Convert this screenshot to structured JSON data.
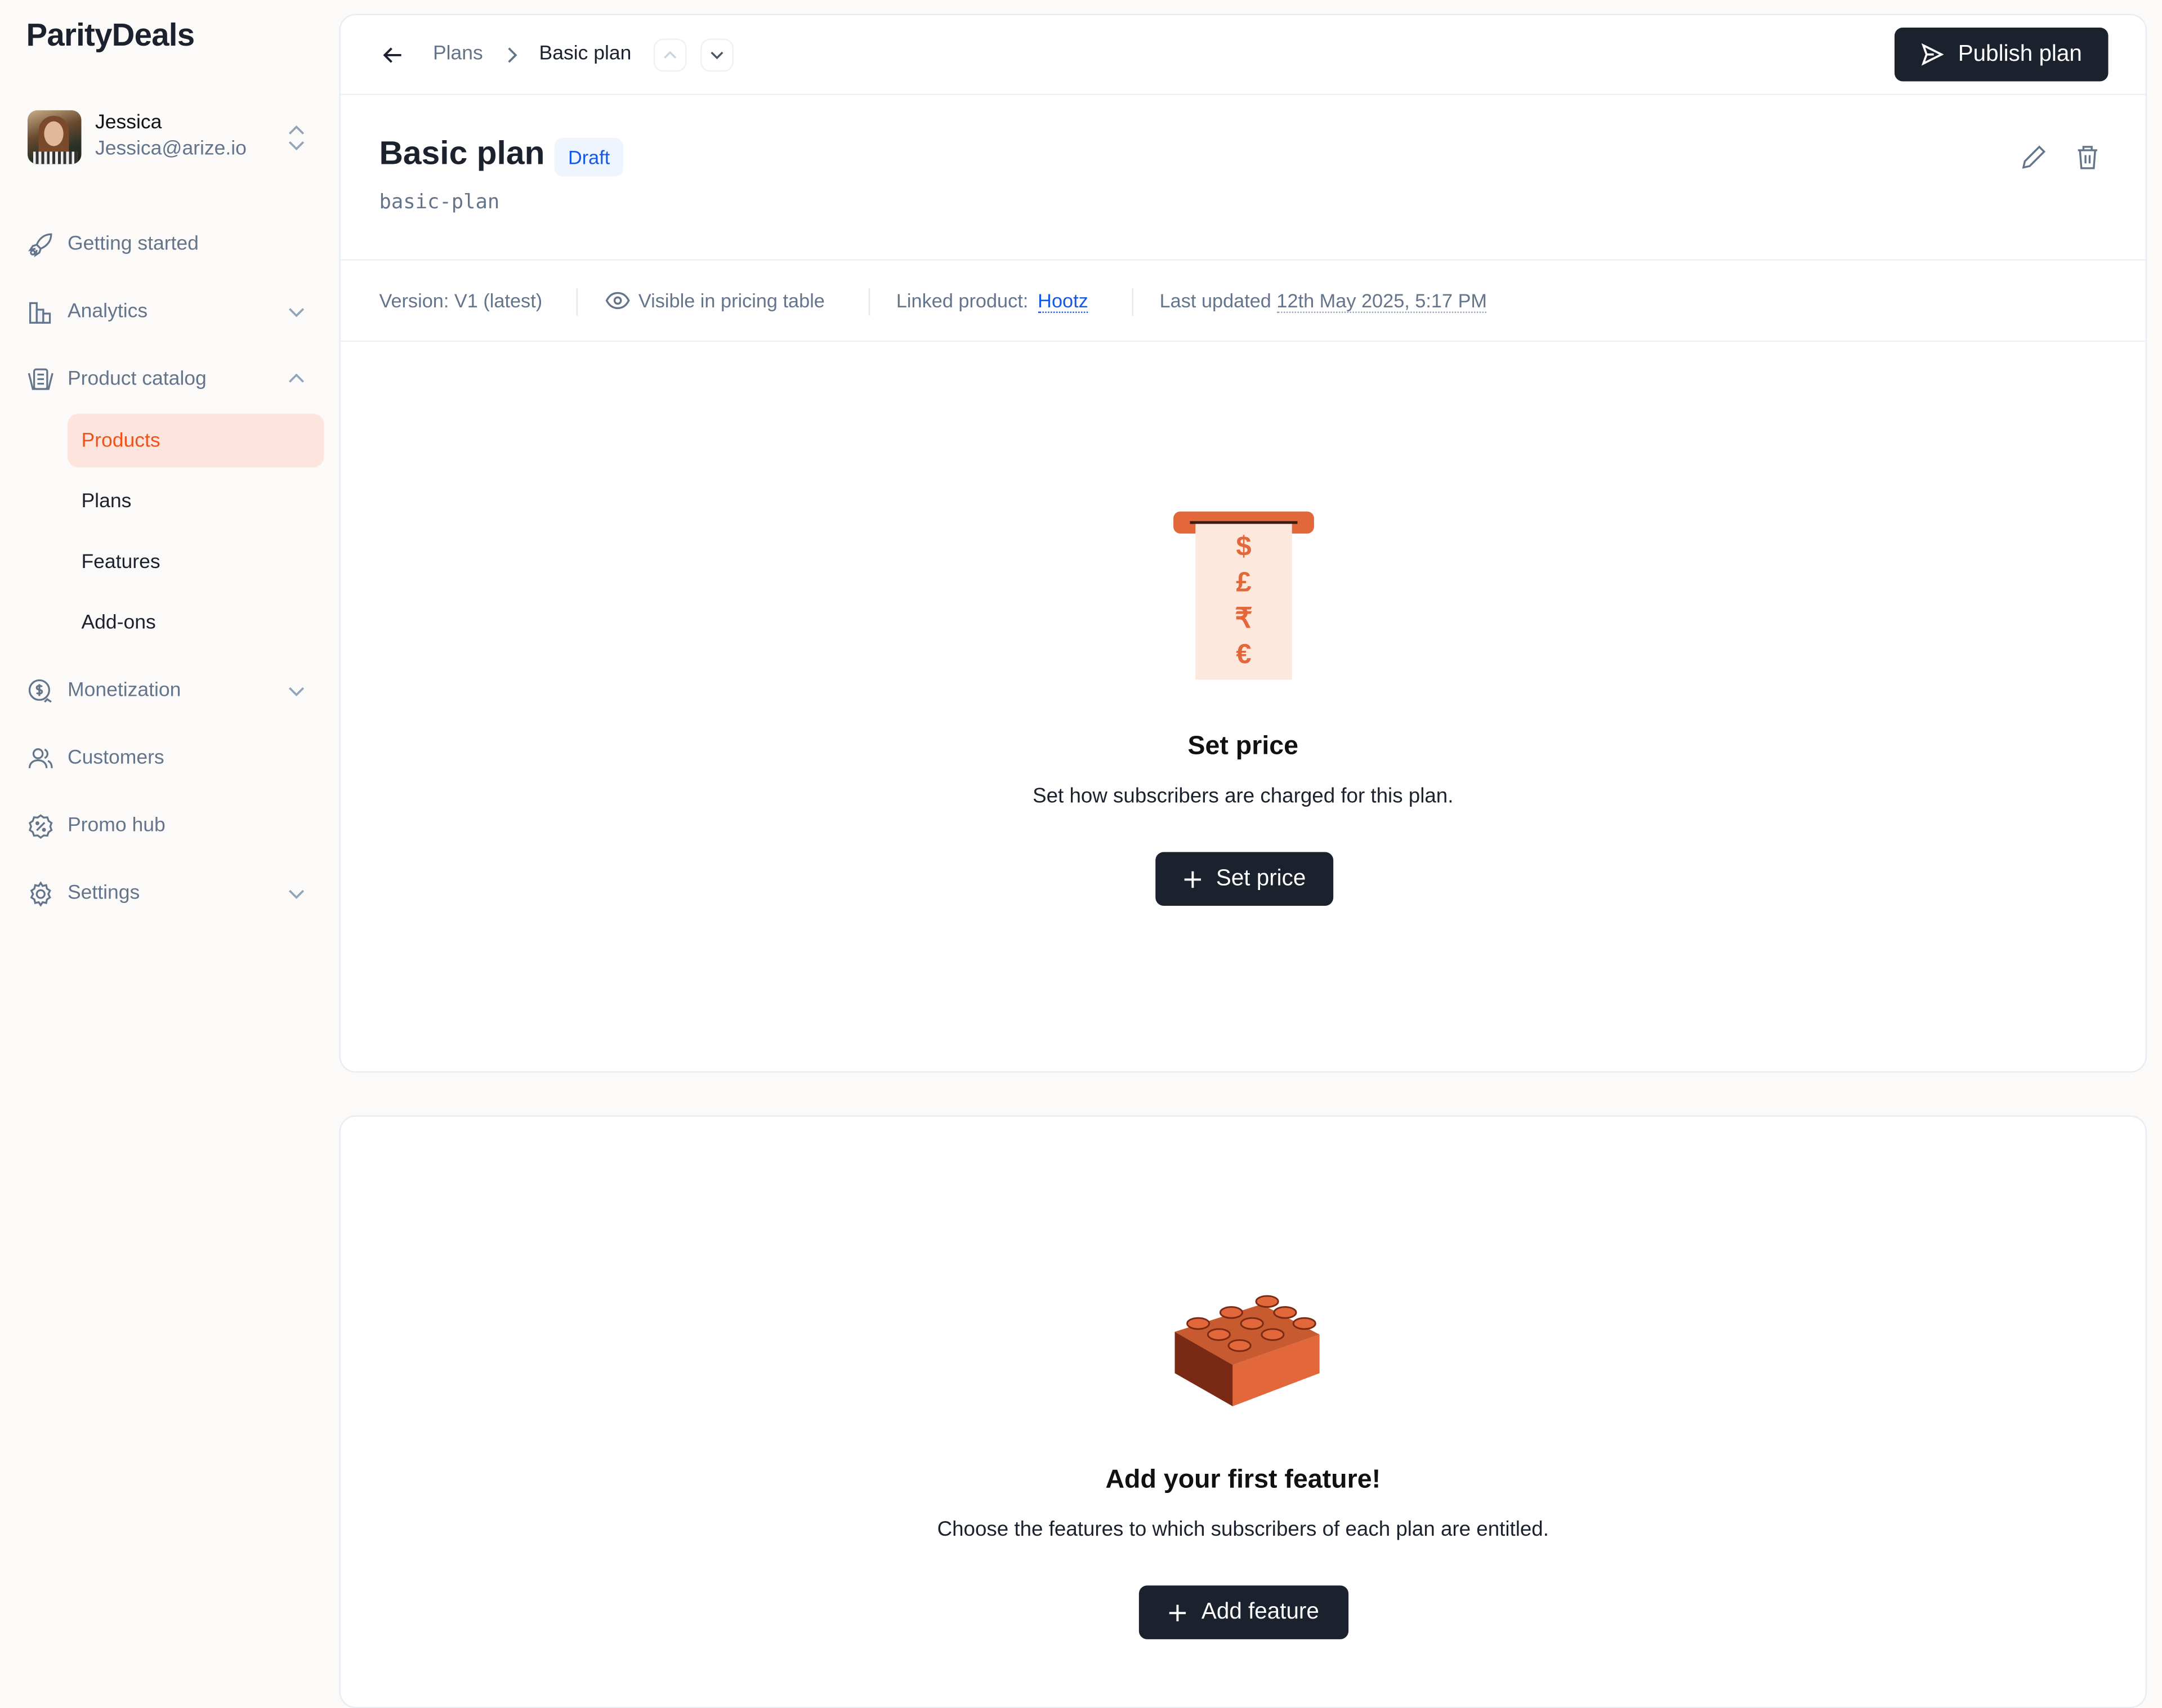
{
  "app": {
    "logo": "ParityDeals"
  },
  "user": {
    "name": "Jessica",
    "email": "Jessica@arize.io"
  },
  "sidebar": {
    "items": [
      {
        "label": "Getting started",
        "icon": "rocket-icon"
      },
      {
        "label": "Analytics",
        "icon": "bar-chart-icon",
        "chevron": "down"
      },
      {
        "label": "Product catalog",
        "icon": "catalog-icon",
        "chevron": "up"
      },
      {
        "label": "Monetization",
        "icon": "coin-icon",
        "chevron": "down"
      },
      {
        "label": "Customers",
        "icon": "users-icon"
      },
      {
        "label": "Promo hub",
        "icon": "badge-icon"
      },
      {
        "label": "Settings",
        "icon": "gear-icon",
        "chevron": "down"
      }
    ],
    "sub_items": [
      {
        "label": "Products",
        "active": true
      },
      {
        "label": "Plans"
      },
      {
        "label": "Features"
      },
      {
        "label": "Add-ons"
      }
    ]
  },
  "header": {
    "breadcrumb": [
      "Plans",
      "Basic plan"
    ],
    "publish_label": "Publish plan"
  },
  "plan": {
    "title": "Basic plan",
    "status": "Draft",
    "slug": "basic-plan",
    "version": "Version: V1 (latest)",
    "visibility": "Visible in pricing table",
    "linked_label": "Linked product:",
    "linked_product": "Hootz",
    "updated_label": "Last updated",
    "updated_value": "12th May 2025, 5:17 PM"
  },
  "price_empty": {
    "symbols": [
      "$",
      "£",
      "₹",
      "€"
    ],
    "title": "Set price",
    "desc": "Set how subscribers are charged for this plan.",
    "button": "Set price"
  },
  "feature_empty": {
    "title": "Add your first feature!",
    "desc": "Choose the features to which subscribers of each plan are entitled.",
    "button": "Add feature"
  },
  "colors": {
    "accent": "#f0521c",
    "active_bg": "#fde5dd",
    "dark": "#1b212d",
    "link": "#1558e6",
    "muted": "#64748b"
  }
}
